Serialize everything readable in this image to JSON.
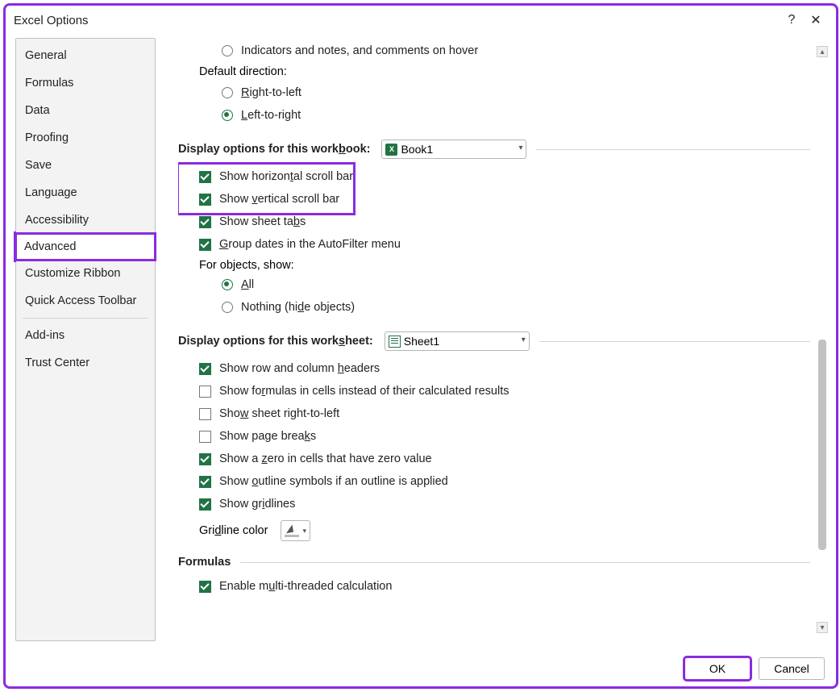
{
  "window": {
    "title": "Excel Options"
  },
  "sidebar": {
    "items": [
      {
        "label": "General"
      },
      {
        "label": "Formulas"
      },
      {
        "label": "Data"
      },
      {
        "label": "Proofing"
      },
      {
        "label": "Save"
      },
      {
        "label": "Language"
      },
      {
        "label": "Accessibility"
      },
      {
        "label": "Advanced",
        "selected": true
      },
      {
        "label": "Customize Ribbon"
      },
      {
        "label": "Quick Access Toolbar"
      },
      {
        "label": "Add-ins"
      },
      {
        "label": "Trust Center"
      }
    ]
  },
  "top_section": {
    "indicators_label": "Indicators and notes, and comments on hover",
    "default_direction_label": "Default direction:",
    "rtl_label": "Right-to-left",
    "ltr_label": "Left-to-right",
    "direction_value": "ltr"
  },
  "workbook_section": {
    "header": "Display options for this workbook:",
    "workbook_name": "Book1",
    "show_h_scroll": {
      "label": "Show horizontal scroll bar",
      "checked": true
    },
    "show_v_scroll": {
      "label": "Show vertical scroll bar",
      "checked": true
    },
    "show_sheet_tabs": {
      "label": "Show sheet tabs",
      "checked": true
    },
    "group_dates": {
      "label": "Group dates in the AutoFilter menu",
      "checked": true
    },
    "for_objects_label": "For objects, show:",
    "obj_all_label": "All",
    "obj_nothing_label": "Nothing (hide objects)",
    "objects_value": "all"
  },
  "worksheet_section": {
    "header": "Display options for this worksheet:",
    "worksheet_name": "Sheet1",
    "row_col_headers": {
      "label": "Show row and column headers",
      "checked": true
    },
    "show_formulas": {
      "label": "Show formulas in cells instead of their calculated results",
      "checked": false
    },
    "sheet_rtl": {
      "label": "Show sheet right-to-left",
      "checked": false
    },
    "page_breaks": {
      "label": "Show page breaks",
      "checked": false
    },
    "show_zero": {
      "label": "Show a zero in cells that have zero value",
      "checked": true
    },
    "outline_symbols": {
      "label": "Show outline symbols if an outline is applied",
      "checked": true
    },
    "gridlines": {
      "label": "Show gridlines",
      "checked": true
    },
    "gridline_color_label": "Gridline color"
  },
  "formulas_section": {
    "header": "Formulas",
    "multithread": {
      "label": "Enable multi-threaded calculation",
      "checked": true
    }
  },
  "buttons": {
    "ok": "OK",
    "cancel": "Cancel"
  }
}
